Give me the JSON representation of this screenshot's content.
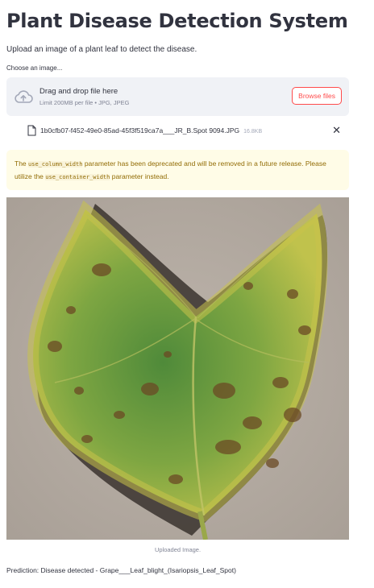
{
  "app": {
    "title": "Plant Disease Detection System",
    "subtitle": "Upload an image of a plant leaf to detect the disease."
  },
  "uploader": {
    "label": "Choose an image...",
    "dropzone_title": "Drag and drop file here",
    "limit_text": "Limit 200MB per file • JPG, JPEG",
    "browse_label": "Browse files",
    "icon": "cloud-upload-icon",
    "file": {
      "name": "1b0cfb07-f452-49e0-85ad-45f3f519ca7a___JR_B.Spot 9094.JPG",
      "size": "16.8KB",
      "icon": "file-icon",
      "remove_glyph": "✕"
    }
  },
  "warning": {
    "text_1": "The ",
    "code_1": "use_column_width",
    "text_2": " parameter has been deprecated and will be removed in a future release. Please utilize the ",
    "code_2": "use_container_width",
    "text_3": " parameter instead."
  },
  "image": {
    "caption": "Uploaded Image."
  },
  "result": {
    "prediction": "Prediction: Disease detected - Grape___Leaf_blight_(Isariopsis_Leaf_Spot)"
  },
  "colors": {
    "accent": "#ff4b4b",
    "text": "#31333f",
    "dropzone_bg": "#f0f2f6",
    "warning_bg": "#fffce7",
    "warning_text": "#926c05"
  }
}
